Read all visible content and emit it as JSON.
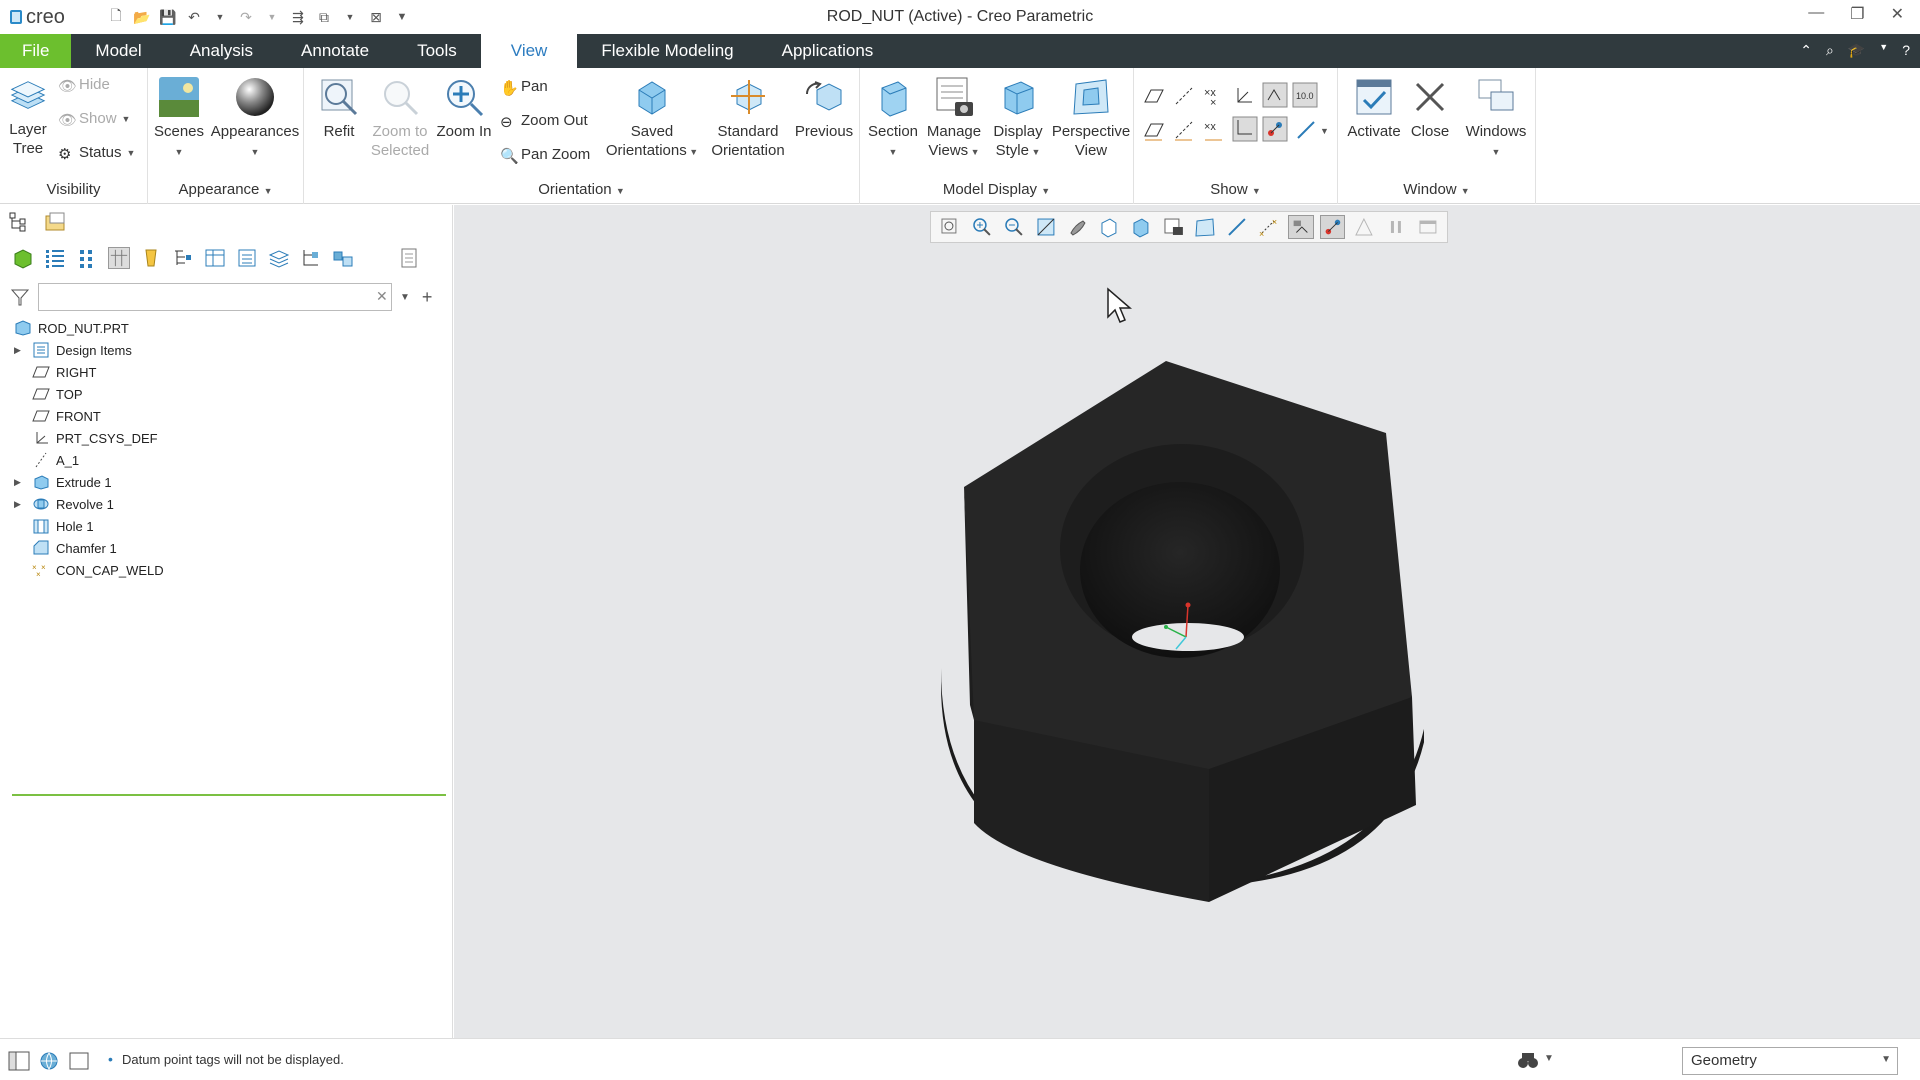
{
  "app": {
    "logo": "creo",
    "title": "ROD_NUT (Active) - Creo Parametric"
  },
  "tabs": [
    "File",
    "Model",
    "Analysis",
    "Annotate",
    "Tools",
    "View",
    "Flexible Modeling",
    "Applications"
  ],
  "active_tab": "View",
  "ribbon": {
    "visibility": {
      "label": "Visibility",
      "layer_tree": "Layer\nTree",
      "hide": "Hide",
      "show": "Show",
      "status": "Status"
    },
    "appearance": {
      "label": "Appearance",
      "scenes": "Scenes",
      "appearances": "Appearances"
    },
    "orientation": {
      "label": "Orientation",
      "refit": "Refit",
      "zoom_to_selected": "Zoom to\nSelected",
      "zoom_in": "Zoom In",
      "pan": "Pan",
      "zoom_out": "Zoom Out",
      "pan_zoom": "Pan Zoom",
      "saved_orientations": "Saved\nOrientations",
      "standard_orientation": "Standard\nOrientation",
      "previous": "Previous"
    },
    "model_display": {
      "label": "Model Display",
      "section": "Section",
      "manage_views": "Manage\nViews",
      "display_style": "Display\nStyle",
      "perspective_view": "Perspective\nView"
    },
    "show": {
      "label": "Show"
    },
    "window": {
      "label": "Window",
      "activate": "Activate",
      "close": "Close",
      "windows": "Windows"
    }
  },
  "model_tree": {
    "root": "ROD_NUT.PRT",
    "items": [
      {
        "label": "Design Items",
        "expandable": true,
        "icon": "design-items-icon"
      },
      {
        "label": "RIGHT",
        "expandable": false,
        "icon": "datum-plane-icon"
      },
      {
        "label": "TOP",
        "expandable": false,
        "icon": "datum-plane-icon"
      },
      {
        "label": "FRONT",
        "expandable": false,
        "icon": "datum-plane-icon"
      },
      {
        "label": "PRT_CSYS_DEF",
        "expandable": false,
        "icon": "csys-icon"
      },
      {
        "label": "A_1",
        "expandable": false,
        "icon": "datum-axis-icon"
      },
      {
        "label": "Extrude 1",
        "expandable": true,
        "icon": "extrude-icon"
      },
      {
        "label": "Revolve 1",
        "expandable": true,
        "icon": "revolve-icon"
      },
      {
        "label": "Hole 1",
        "expandable": false,
        "icon": "hole-icon"
      },
      {
        "label": "Chamfer 1",
        "expandable": false,
        "icon": "chamfer-icon"
      },
      {
        "label": "CON_CAP_WELD",
        "expandable": false,
        "icon": "weld-icon"
      }
    ]
  },
  "search": {
    "value": "",
    "placeholder": ""
  },
  "status": {
    "message": "Datum point tags will not be displayed."
  },
  "selection_filter": "Geometry",
  "colors": {
    "accent": "#6cbf2e",
    "tabbar": "#303a3e",
    "active_tab_text": "#2c7cc0",
    "model": "#222222",
    "viewport_bg": "#e6e7e9"
  }
}
